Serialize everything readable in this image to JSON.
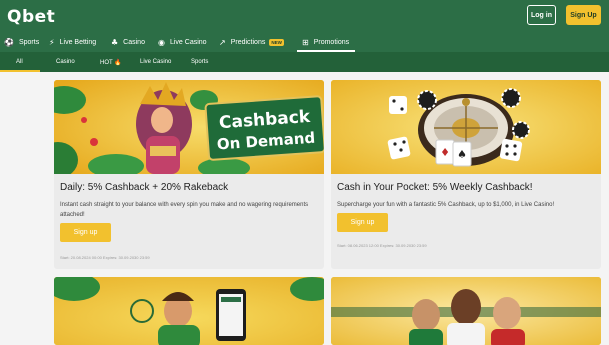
{
  "header": {
    "logo": "Qbet",
    "login_label": "Log in",
    "signup_label": "Sign Up"
  },
  "main_nav": [
    {
      "label": "Sports",
      "icon": "sports-icon",
      "glyph": "⚽"
    },
    {
      "label": "Live Betting",
      "icon": "lightning-icon",
      "glyph": "⚡"
    },
    {
      "label": "Casino",
      "icon": "casino-icon",
      "glyph": "♣"
    },
    {
      "label": "Live Casino",
      "icon": "live-casino-icon",
      "glyph": "◉"
    },
    {
      "label": "Predictions",
      "icon": "trend-icon",
      "glyph": "↗",
      "badge": "NEW"
    },
    {
      "label": "Promotions",
      "icon": "gift-icon",
      "glyph": "⊞",
      "active": true
    }
  ],
  "sub_nav": [
    {
      "label": "All",
      "active": true
    },
    {
      "label": "Casino"
    },
    {
      "label": "HOT 🔥"
    },
    {
      "label": "Live Casino"
    },
    {
      "label": "Sports"
    }
  ],
  "promotions": [
    {
      "banner_text_line1": "Cashback",
      "banner_text_line2": "On Demand",
      "title": "Daily: 5% Cashback + 20% Rakeback",
      "description": "Instant cash straight to your balance with every spin you make and no wagering requirements attached!",
      "button_label": "Sign up",
      "dates": "Start: 20.08.2024 00:00   Expires: 30.09.2030 23:59"
    },
    {
      "title": "Cash in Your Pocket: 5% Weekly Cashback!",
      "description": "Supercharge your fun with a fantastic 5% Cashback, up to $1,000, in Live Casino!",
      "button_label": "Sign up",
      "dates": "Start: 08.06.2023 12:00   Expires: 30.09.2030 23:59"
    }
  ],
  "colors": {
    "brand_green": "#2c6e46",
    "subnav_green": "#236139",
    "accent_yellow": "#f2c12e"
  }
}
